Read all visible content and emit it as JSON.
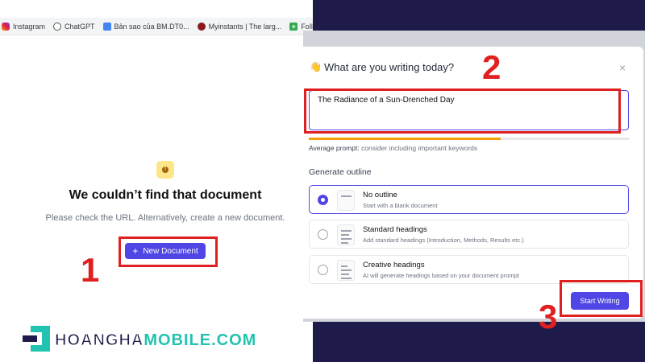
{
  "bookmarks": [
    {
      "label": "Instagram",
      "icon": "instagram-icon"
    },
    {
      "label": "ChatGPT",
      "icon": "chatgpt-icon"
    },
    {
      "label": "Bản sao của BM.DT0...",
      "icon": "google-docs-icon"
    },
    {
      "label": "Myinstants | The larg...",
      "icon": "myinstants-icon"
    },
    {
      "label": "Follow C",
      "icon": "plus-icon"
    }
  ],
  "error": {
    "title": "We couldn’t find that document",
    "subtitle": "Please check the URL. Alternatively, create a new document.",
    "new_document_label": "New Document",
    "plus": "+"
  },
  "dialog": {
    "title": "What are you writing today?",
    "wave_icon": "👋",
    "close_icon": "×",
    "prompt_value": "The Radiance of a Sun-Drenched Day",
    "prompt_quality": 0.6,
    "hint_strong": "Average prompt:",
    "hint_rest": "consider including important keywords",
    "section_label": "Generate outline",
    "options": [
      {
        "title": "No outline",
        "desc": "Start with a blank document",
        "selected": true
      },
      {
        "title": "Standard headings",
        "desc": "Add standard headings (Introduction, Methods, Results etc.)",
        "selected": false
      },
      {
        "title": "Creative headings",
        "desc": "AI will generate headings based on your document prompt",
        "selected": false
      }
    ],
    "start_label": "Start Writing"
  },
  "annotations": {
    "step1": "1",
    "step2": "2",
    "step3": "3"
  },
  "logo": {
    "part1": "HOANGHA",
    "part2": "MOBILE.COM"
  },
  "colors": {
    "accent": "#4f46e5",
    "annotation_red": "#e02020",
    "logo_teal": "#22c3b0",
    "warning": "#f59e0b"
  }
}
